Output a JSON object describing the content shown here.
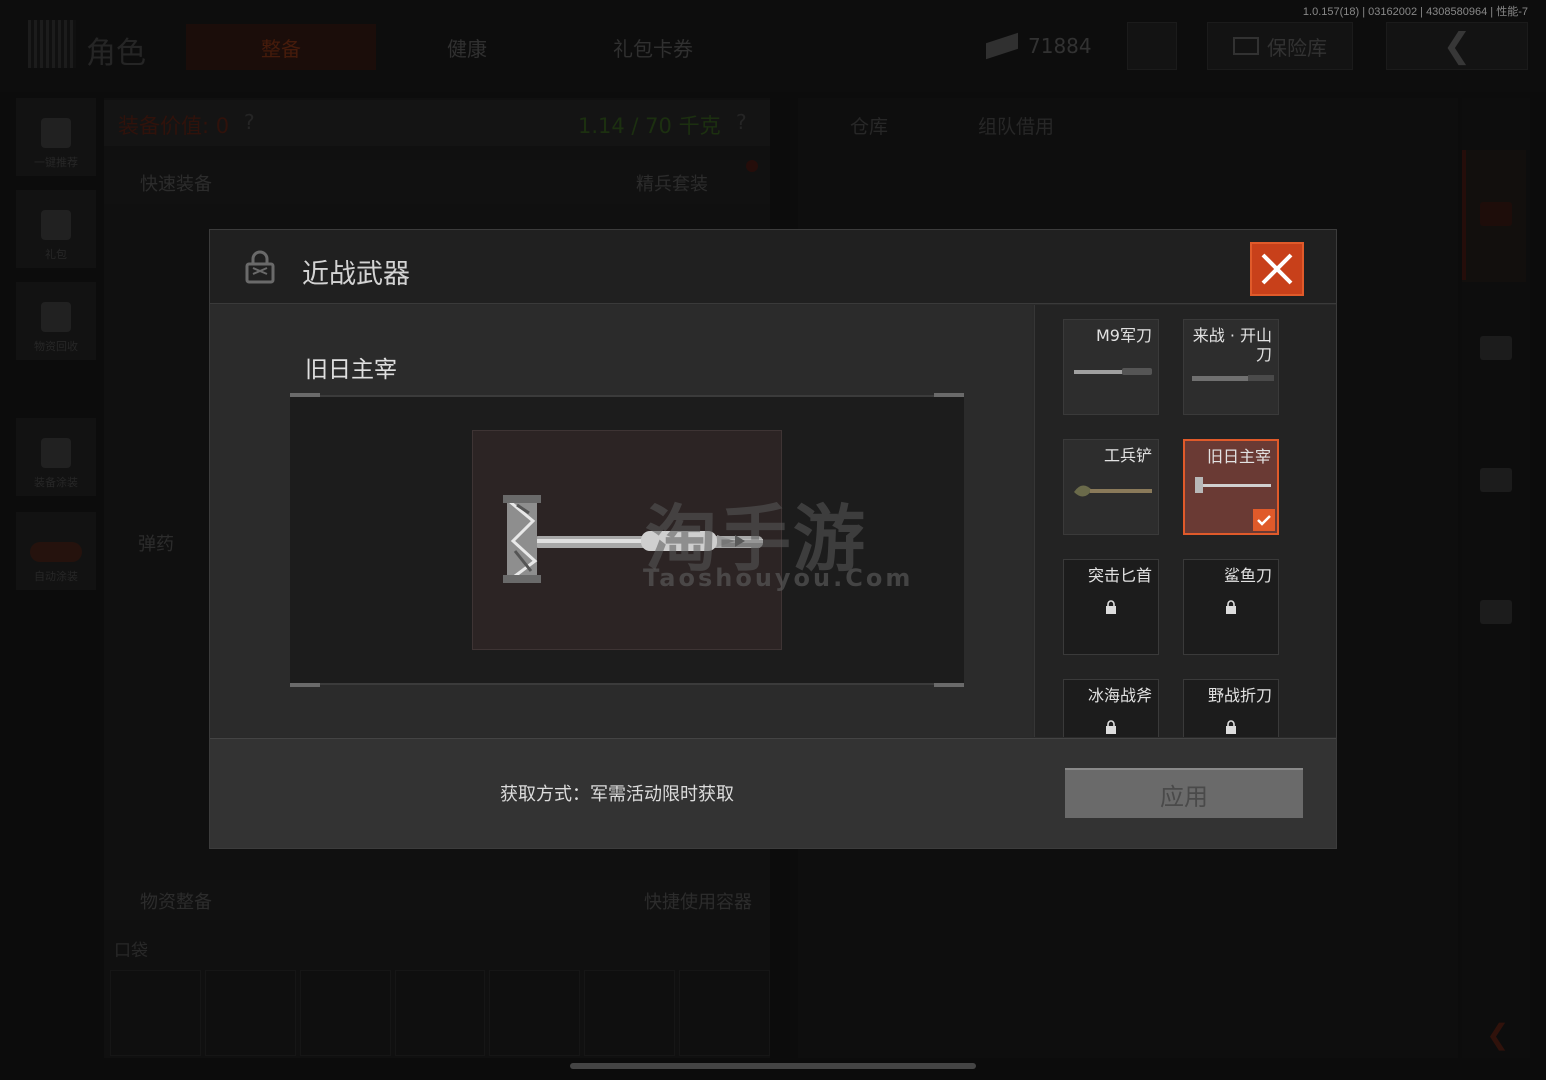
{
  "build_info": "1.0.157(18) | 03162002 | 4308580964 | 性能-7",
  "background": {
    "role_title": "角色",
    "tabs": [
      "整备",
      "健康",
      "礼包卡券"
    ],
    "currency_value": "71884",
    "vault_label": "保险库",
    "left_nav": [
      "一键推荐",
      "礼包",
      "物资回收",
      "装备涂装",
      "自动涂装"
    ],
    "equip_value_label": "装备价值: 0",
    "weight_label": "1.14 / 70 千克",
    "quick_equip": "快速装备",
    "elite_set": "精兵套装",
    "ammo_label": "弹药",
    "supply_label": "物资整备",
    "quick_container": "快捷使用容器",
    "pocket_label": "口袋",
    "right_tabs": [
      "仓库",
      "组队借用"
    ],
    "accent_color": "#e05a2a"
  },
  "modal": {
    "title": "近战武器",
    "selected_weapon_name": "旧日主宰",
    "watermark": "淘手游",
    "watermark_sub": "Taoshouyou.Com",
    "obtain_text": "获取方式：军需活动限时获取",
    "apply_label": "应用",
    "weapons": [
      {
        "name": "M9军刀",
        "locked": false,
        "selected": false
      },
      {
        "name": "来战 · 开山刀",
        "locked": false,
        "selected": false
      },
      {
        "name": "工兵铲",
        "locked": false,
        "selected": false
      },
      {
        "name": "旧日主宰",
        "locked": false,
        "selected": true
      },
      {
        "name": "突击匕首",
        "locked": true,
        "selected": false
      },
      {
        "name": "鲨鱼刀",
        "locked": true,
        "selected": false
      },
      {
        "name": "冰海战斧",
        "locked": true,
        "selected": false
      },
      {
        "name": "野战折刀",
        "locked": true,
        "selected": false
      }
    ]
  }
}
